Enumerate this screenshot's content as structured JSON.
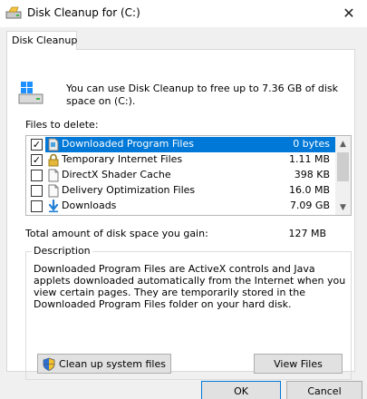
{
  "window": {
    "title": "Disk Cleanup for  (C:)",
    "close_glyph": "✕"
  },
  "tab": {
    "label": "Disk Cleanup"
  },
  "intro": {
    "text": "You can use Disk Cleanup to free up to 7.36 GB of disk space on (C:)."
  },
  "files": {
    "label": "Files to delete:",
    "items": [
      {
        "name": "Downloaded Program Files",
        "size": "0 bytes",
        "checked": true,
        "selected": true,
        "icon": "file-icon"
      },
      {
        "name": "Temporary Internet Files",
        "size": "1.11 MB",
        "checked": true,
        "selected": false,
        "icon": "lock-icon"
      },
      {
        "name": "DirectX Shader Cache",
        "size": "398 KB",
        "checked": false,
        "selected": false,
        "icon": "file-icon"
      },
      {
        "name": "Delivery Optimization Files",
        "size": "16.0 MB",
        "checked": false,
        "selected": false,
        "icon": "file-icon"
      },
      {
        "name": "Downloads",
        "size": "7.09 GB",
        "checked": false,
        "selected": false,
        "icon": "download-arrow-icon"
      }
    ]
  },
  "total": {
    "label": "Total amount of disk space you gain:",
    "value": "127 MB"
  },
  "description": {
    "legend": "Description",
    "text": "Downloaded Program Files are ActiveX controls and Java applets downloaded automatically from the Internet when you view certain pages. They are temporarily stored in the Downloaded Program Files folder on your hard disk."
  },
  "buttons": {
    "cleanup": "Clean up system files",
    "view": "View Files",
    "ok": "OK",
    "cancel": "Cancel"
  },
  "colors": {
    "selection": "#0078d7",
    "client_bg": "#f0f0f0"
  }
}
